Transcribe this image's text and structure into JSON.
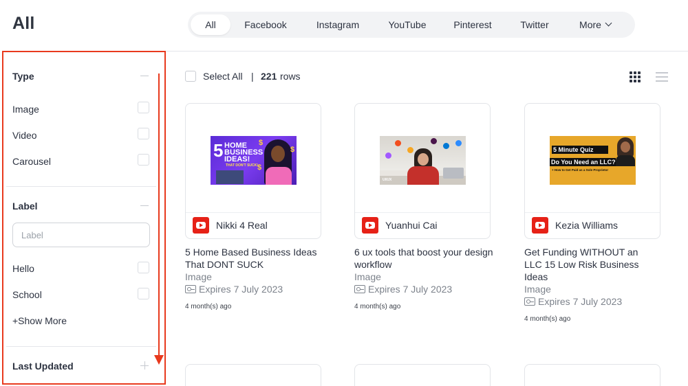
{
  "page": {
    "title": "All"
  },
  "tabs": [
    {
      "label": "All",
      "active": true
    },
    {
      "label": "Facebook"
    },
    {
      "label": "Instagram"
    },
    {
      "label": "YouTube"
    },
    {
      "label": "Pinterest"
    },
    {
      "label": "Twitter"
    },
    {
      "label": "More"
    }
  ],
  "filters": {
    "type": {
      "title": "Type",
      "options": [
        "Image",
        "Video",
        "Carousel"
      ]
    },
    "label": {
      "title": "Label",
      "placeholder": "Label",
      "options": [
        "Hello",
        "School"
      ],
      "show_more": "+Show More"
    },
    "last_updated": {
      "title": "Last Updated"
    }
  },
  "toolbar": {
    "select_all": "Select All",
    "separator": "|",
    "row_count": "221",
    "rows_word": "rows"
  },
  "thumbnail_text": {
    "card1": {
      "five": "5",
      "lines": "HOME\nBUSINESS\nIDEAS!",
      "sub": "THAT DON'T SUCK!",
      "dollar": "$"
    },
    "card2": {
      "label": "UI/UX"
    },
    "card3": {
      "quiz": "5 Minute Quiz",
      "question": "Do You Need an LLC?",
      "sub": "+ How to Get Paid as a Sole Proprietor"
    }
  },
  "cards": [
    {
      "channel": "Nikki 4 Real",
      "platform_icon": "youtube-icon",
      "title": "5 Home Based Business Ideas That DONT SUCK",
      "type": "Image",
      "expires": "Expires 7 July 2023",
      "ago": "4 month(s) ago"
    },
    {
      "channel": "Yuanhui Cai",
      "platform_icon": "youtube-icon",
      "title": "6 ux tools that boost your design workflow",
      "type": "Image",
      "expires": "Expires 7 July 2023",
      "ago": "4 month(s) ago"
    },
    {
      "channel": "Kezia Williams",
      "platform_icon": "youtube-icon",
      "title": "Get Funding WITHOUT an LLC 15 Low Risk Business Ideas",
      "type": "Image",
      "expires": "Expires 7 July 2023",
      "ago": "4 month(s) ago"
    }
  ],
  "colors": {
    "annotation": "#e8391d",
    "youtube": "#e62117",
    "text": "#2c3240",
    "muted": "#7c828b"
  }
}
